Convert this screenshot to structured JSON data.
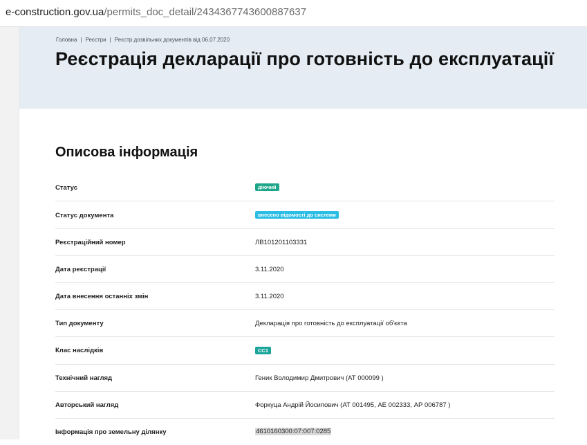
{
  "browser": {
    "url_host": "e-construction.gov.ua",
    "url_path": "/permits_doc_detail/2434367743600887637"
  },
  "breadcrumb": {
    "items": [
      "Головна",
      "Реєстри",
      "Реєстр дозвільних документів від 06.07.2020"
    ],
    "separator": "|"
  },
  "page": {
    "title": "Реєстрація декларації про готовність до експлуатації"
  },
  "section": {
    "title": "Описова інформація"
  },
  "info": {
    "status": {
      "label": "Статус",
      "value": "діючий"
    },
    "doc_status": {
      "label": "Статус документа",
      "value": "внесено відомості до системи"
    },
    "reg_number": {
      "label": "Реєстраційний номер",
      "value": "ЛВ101201103331"
    },
    "reg_date": {
      "label": "Дата реєстрації",
      "value": "3.11.2020"
    },
    "last_change_date": {
      "label": "Дата внесення останніх змін",
      "value": "3.11.2020"
    },
    "doc_type": {
      "label": "Тип документу",
      "value": "Декларація про готовність до експлуатації об'єкта"
    },
    "consequence_class": {
      "label": "Клас наслідків",
      "value": "СС1"
    },
    "tech_supervision": {
      "label": "Технічний нагляд",
      "value": "Геник Володимир Дмитрович (АТ 000099 )"
    },
    "author_supervision": {
      "label": "Авторський нагляд",
      "value": "Форкуца Андрій Йосипович (АТ 001495, АЕ 002333, АР 006787 )"
    },
    "land_info": {
      "label": "Інформація про земельну ділянку",
      "value": "4610160300:07:007:0285"
    }
  },
  "colors": {
    "hero_bg": "#e5ecf3",
    "badge_active": "#1ea68a",
    "badge_system": "#2bbde3",
    "badge_class": "#1aa49a"
  }
}
